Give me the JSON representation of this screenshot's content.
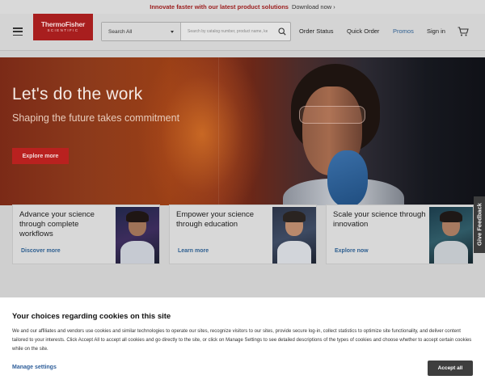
{
  "promo_bar": {
    "highlight": "Innovate faster with our latest product solutions",
    "link": "Download now ›"
  },
  "header": {
    "logo_main": "ThermoFisher",
    "logo_sub": "SCIENTIFIC",
    "search": {
      "category": "Search All",
      "placeholder": "Search by catalog number, product name, keyword"
    },
    "nav": [
      "Order Status",
      "Quick Order",
      "Promos",
      "Sign in"
    ],
    "active_nav": "Promos"
  },
  "hero": {
    "title": "Let's do the work",
    "subtitle": "Shaping the future takes commitment",
    "button": "Explore more"
  },
  "cards": [
    {
      "title": "Advance your science through complete workflows",
      "link": "Discover more"
    },
    {
      "title": "Empower your science through education",
      "link": "Learn more"
    },
    {
      "title": "Scale your science through innovation",
      "link": "Explore now"
    }
  ],
  "feedback_tab": "Give Feedback",
  "cookie_banner": {
    "title": "Your choices regarding cookies on this site",
    "text": "We and our affiliates and vendors use cookies and similar technologies to operate our sites, recognize visitors to our sites, provide secure log-in, collect statistics to optimize site functionality, and deliver content tailored to your interests. Click Accept All to accept all cookies and go directly to the site, or click on Manage Settings to see detailed descriptions of the types of cookies and choose whether to accept certain cookies while on the site.",
    "manage": "Manage settings",
    "accept": "Accept all"
  },
  "colors": {
    "brand_red": "#a81e1e",
    "link_blue": "#2e5f90"
  }
}
